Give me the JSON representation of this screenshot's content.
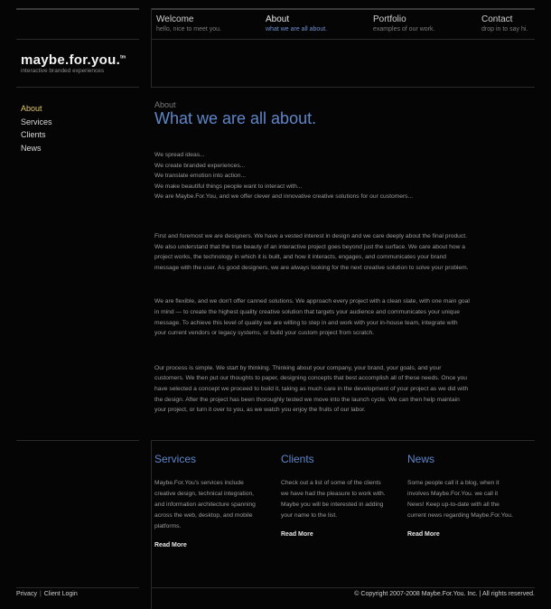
{
  "nav": [
    {
      "title": "Welcome",
      "sub": "hello, nice to meet you."
    },
    {
      "title": "About",
      "sub": "what we are all about."
    },
    {
      "title": "Portfolio",
      "sub": "examples of our work."
    },
    {
      "title": "Contact",
      "sub": "drop in to say hi."
    }
  ],
  "logo": {
    "main": "maybe.for.you.",
    "tm": "tm",
    "tagline": "interactive branded experiences"
  },
  "sidebar": [
    "About",
    "Services",
    "Clients",
    "News"
  ],
  "content": {
    "eyebrow": "About",
    "headline": "What we are all about.",
    "p1": "We spread ideas...\nWe create branded experiences...\nWe translate emotion into action...\nWe make beautiful things people want to interact with...\nWe are Maybe.For.You, and we offer clever and innovative creative solutions for our customers...",
    "p2": "First and foremost we are designers. We have a vested interest in design and we care deeply about the final product. We also understand that the true beauty of an interactive project goes beyond just the surface. We care about how a project works, the technology in which it is built, and how it interacts, engages, and communicates your brand message with the user. As good designers, we are always looking for the next creative solution to solve your problem.",
    "p3": "We are flexible, and we don't offer canned solutions. We approach every project with a clean slate, with one main goal in mind — to create the highest quality creative solution that targets your audience and communicates your unique message. To achieve this level of quality we are willing to step in and work with your in-house team, integrate with your current vendors or legacy systems, or build your custom project from scratch.",
    "p4": "Our process is simple. We start by thinking. Thinking about your company, your brand, your goals, and your customers. We then put our thoughts to paper, designing concepts that best accomplish all of these needs. Once you have selected a concept we proceed to build it, taking as much care in the development of your project as we did with the design. After the project has been thoroughly tested we move into the launch cycle. We can then help maintain your project, or turn it over to you, as we watch you enjoy the fruits of our labor."
  },
  "columns": [
    {
      "title": "Services",
      "body": "Maybe.For.You's services include creative design, technical integration, and information architecture spanning across the web, desktop, and mobile platforms.",
      "more": "Read More"
    },
    {
      "title": "Clients",
      "body": "Check out a list of some of the clients we have had the pleasure to work with. Maybe you will be interested in adding your name to the list.",
      "more": "Read More"
    },
    {
      "title": "News",
      "body": "Some people call it a blog, when it involves Maybe.For.You. we call it News! Keep up-to-date with all the current news regarding Maybe.For.You.",
      "more": "Read More"
    }
  ],
  "footer": {
    "privacy": "Privacy",
    "separator": "|",
    "client_login": "Client Login",
    "copyright": "© Copyright 2007-2008 Maybe.For.You. Inc. | All rights reserved."
  },
  "colors": {
    "accent_blue": "#5f86c9",
    "active_gold": "#e2c66a",
    "background": "#050505"
  }
}
